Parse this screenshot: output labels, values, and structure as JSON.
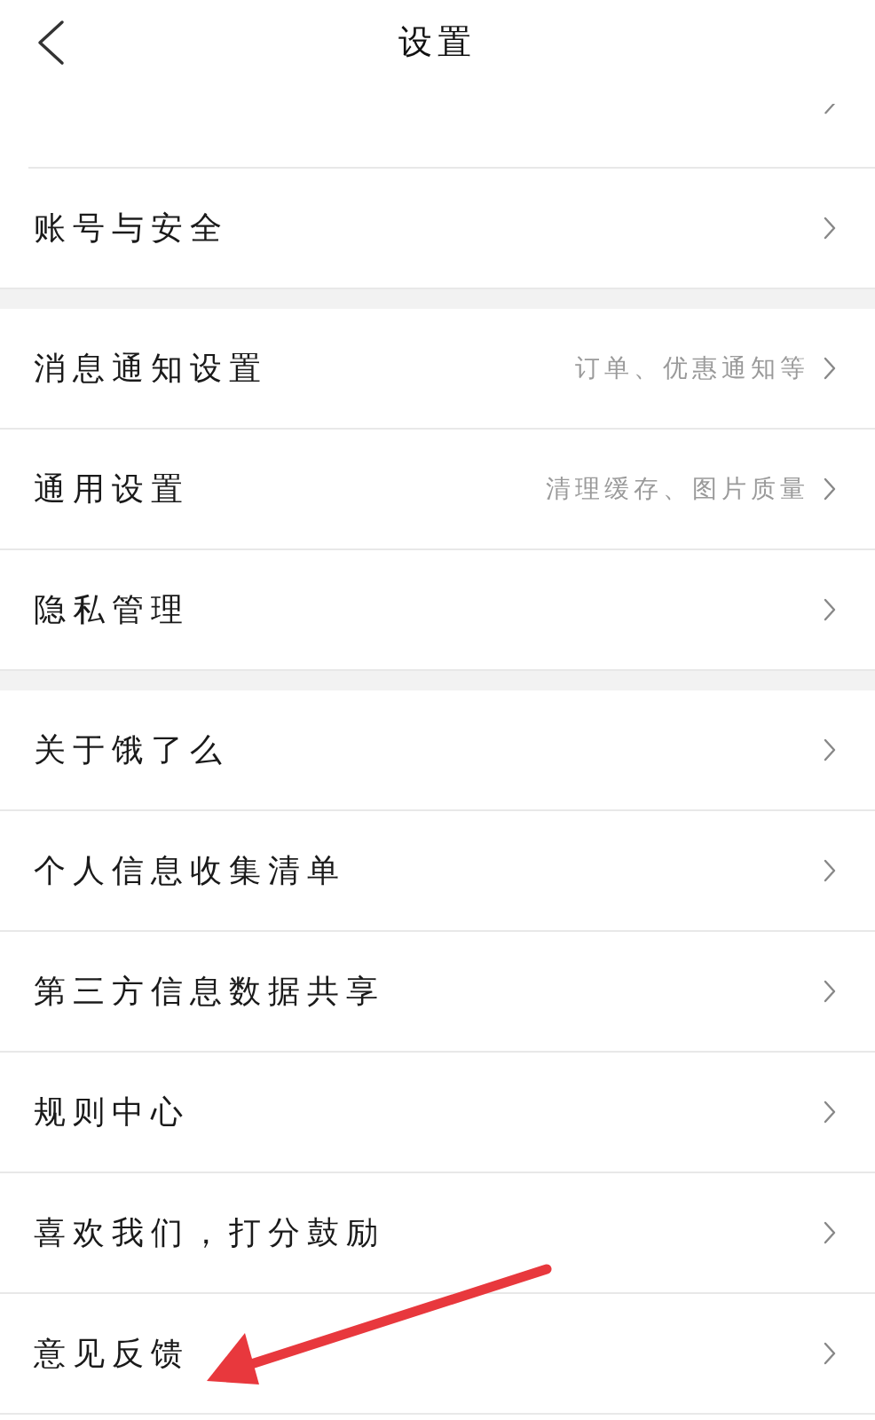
{
  "header": {
    "title": "设置"
  },
  "sections": [
    {
      "items": [
        {
          "label": "账号与安全"
        }
      ]
    },
    {
      "items": [
        {
          "label": "消息通知设置",
          "detail": "订单、优惠通知等"
        },
        {
          "label": "通用设置",
          "detail": "清理缓存、图片质量"
        },
        {
          "label": "隐私管理"
        }
      ]
    },
    {
      "items": [
        {
          "label": "关于饿了么"
        },
        {
          "label": "个人信息收集清单"
        },
        {
          "label": "第三方信息数据共享"
        },
        {
          "label": "规则中心"
        },
        {
          "label": "喜欢我们，打分鼓励"
        },
        {
          "label": "意见反馈"
        }
      ]
    }
  ]
}
